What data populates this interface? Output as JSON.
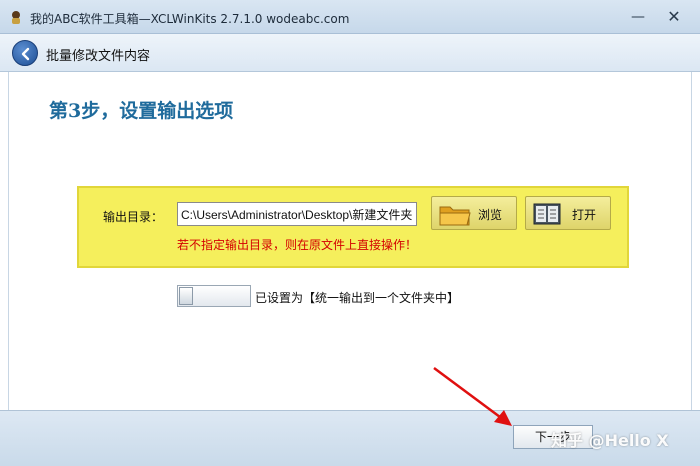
{
  "window": {
    "title": "我的ABC软件工具箱—XCLWinKits 2.7.1.0  wodeabc.com",
    "minimize_glyph": "—",
    "close_glyph": "✕"
  },
  "nav": {
    "title": "批量修改文件内容"
  },
  "step": {
    "heading": "第3步，设置输出选项"
  },
  "output": {
    "label": "输出目录：",
    "path_value": "C:\\Users\\Administrator\\Desktop\\新建文件夹",
    "browse_label": "浏览",
    "open_label": "打开",
    "warning": "若不指定输出目录，则在原文件上直接操作！"
  },
  "option": {
    "toggle_state": "off",
    "label": "已设置为【统一输出到一个文件夹中】"
  },
  "footer": {
    "next_label": "下一步"
  },
  "watermark": {
    "text": "知乎 @Hello X"
  },
  "colors": {
    "heading": "#1f6b9c",
    "panel": "#f5ef5c",
    "warning": "#d40000",
    "arrow": "#e01010"
  },
  "icons": {
    "app": "app-logo-icon",
    "back": "back-arrow-icon",
    "browse": "folder-icon",
    "open": "book-icon"
  }
}
